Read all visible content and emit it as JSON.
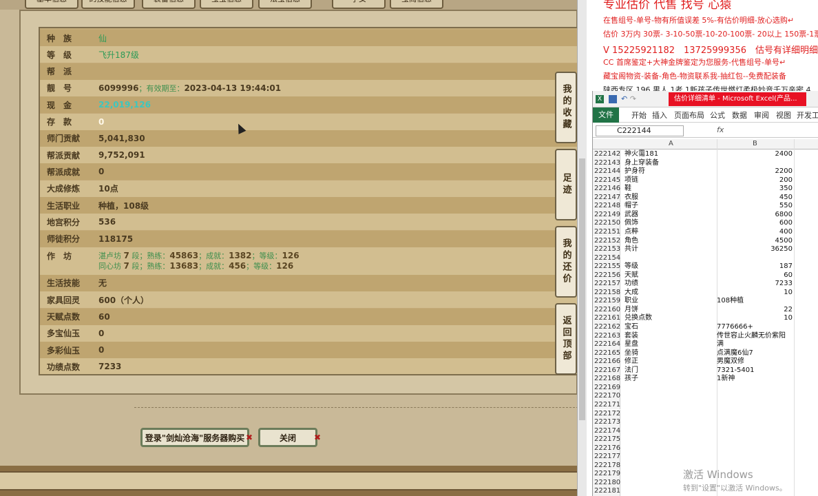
{
  "game": {
    "tabs": [
      "基本信息",
      "的技能信息",
      "装备信息",
      "宝宝信息",
      "法宝信息",
      "子女",
      "宝阁信息"
    ],
    "rows": [
      {
        "label": "种　族",
        "value": "仙",
        "style": "green"
      },
      {
        "label": "等　级",
        "value": "飞升187级",
        "style": "green"
      },
      {
        "label": "帮　派",
        "value": "",
        "style": ""
      },
      {
        "label": "靓　号",
        "value": "6099996",
        "sub": "；有效期至：",
        "value2": "2023-04-13 19:44:01",
        "style": ""
      },
      {
        "label": "现　金",
        "value": "22,019,126",
        "style": "teal"
      },
      {
        "label": "存　款",
        "value": "0",
        "style": "white"
      },
      {
        "label": "师门贡献",
        "value": "5,041,830",
        "style": ""
      },
      {
        "label": "帮派贡献",
        "value": "9,752,091",
        "style": ""
      },
      {
        "label": "帮派成就",
        "value": "0",
        "style": ""
      },
      {
        "label": "大成修炼",
        "value": "10点",
        "style": ""
      },
      {
        "label": "生活职业",
        "value": "种植，108级",
        "style": ""
      },
      {
        "label": "地宫积分",
        "value": "536",
        "style": ""
      },
      {
        "label": "师徒积分",
        "value": "118175",
        "style": ""
      },
      {
        "label": "生活技能",
        "value": "无",
        "style": ""
      },
      {
        "label": "家具回灵",
        "value": "600（个人）",
        "style": ""
      },
      {
        "label": "天赋点数",
        "value": "60",
        "style": ""
      },
      {
        "label": "多宝仙玉",
        "value": "0",
        "style": ""
      },
      {
        "label": "多彩仙玉",
        "value": "0",
        "style": ""
      },
      {
        "label": "功绩点数",
        "value": "7233",
        "style": ""
      }
    ],
    "workshop": {
      "label": "作　坊",
      "line1": {
        "name": "湛卢坊",
        "lvl": "7",
        "t1": "段；熟练：",
        "v1": "45863",
        "t2": "；成就：",
        "v2": "1382",
        "t3": "；等级：",
        "v3": "126"
      },
      "line2": {
        "name": "同心坊",
        "lvl": "7",
        "t1": "段；熟练：",
        "v1": "13683",
        "t2": "；成就：",
        "v2": "456",
        "t3": "；等级：",
        "v3": "126"
      }
    },
    "side_buttons": [
      "我的收藏",
      "足迹",
      "我的还价",
      "返回顶部"
    ],
    "login_button": "登录\"剑灿沧海\"服务器购买",
    "close_button": "关闭"
  },
  "ad": {
    "line0": "专业估价 代售 找号 心猿",
    "line1": "在售组号-单号-物有所值误差 5%-有估价明细-放心选购↵",
    "line2": "估价 3万内 30票- 3-10-50票-10-20-100票- 20以上 150票-1票",
    "line3": "V 15225921182　13725999356　估号有详细明细",
    "line4": "CC 首席鉴定+大神金牌鉴定为您服务-代售组号-单号↵",
    "line5": "藏宝阁物资-装备-角色-物资联系我-抽红包--免费配装备",
    "line6": "陕西专区 196 男人 1老 1新孩子传世燃灯柔极妙音千万亲密 4"
  },
  "excel": {
    "window_title": "估价详细清单 - Microsoft Excel(产品...",
    "ribbon_tabs": [
      "文件",
      "开始",
      "插入",
      "页面布局",
      "公式",
      "数据",
      "审阅",
      "视图",
      "开发工"
    ],
    "name_box": "C222144",
    "fx": "fx",
    "col_a": "A",
    "col_b": "B",
    "rows": [
      {
        "n": "222142",
        "a": "神火霭181",
        "b": "2400",
        "num": true
      },
      {
        "n": "222143",
        "a": "身上穿装备",
        "b": "",
        "num": true
      },
      {
        "n": "222144",
        "a": "护身符",
        "b": "2200",
        "num": true
      },
      {
        "n": "222145",
        "a": "项链",
        "b": "200",
        "num": true
      },
      {
        "n": "222146",
        "a": "鞋",
        "b": "350",
        "num": true
      },
      {
        "n": "222147",
        "a": "衣服",
        "b": "450",
        "num": true
      },
      {
        "n": "222148",
        "a": "帽子",
        "b": "550",
        "num": true
      },
      {
        "n": "222149",
        "a": "武器",
        "b": "6800",
        "num": true
      },
      {
        "n": "222150",
        "a": "佩饰",
        "b": "600",
        "num": true
      },
      {
        "n": "222151",
        "a": "点粹",
        "b": "400",
        "num": true
      },
      {
        "n": "222152",
        "a": "角色",
        "b": "4500",
        "num": true
      },
      {
        "n": "222153",
        "a": "共计",
        "b": "36250",
        "num": true
      },
      {
        "n": "222154",
        "a": "",
        "b": "",
        "num": true
      },
      {
        "n": "222155",
        "a": "等级",
        "b": "187",
        "num": true
      },
      {
        "n": "222156",
        "a": "天赋",
        "b": "60",
        "num": true
      },
      {
        "n": "222157",
        "a": "功绩",
        "b": "7233",
        "num": true
      },
      {
        "n": "222158",
        "a": "大成",
        "b": "10",
        "num": true
      },
      {
        "n": "222159",
        "a": "职业",
        "b": "108种植",
        "num": false
      },
      {
        "n": "222160",
        "a": "月饼",
        "b": "22",
        "num": true
      },
      {
        "n": "222161",
        "a": "兑换点数",
        "b": "10",
        "num": true
      },
      {
        "n": "222162",
        "a": "宝石",
        "b": "7776666+",
        "num": false
      },
      {
        "n": "222163",
        "a": "套装",
        "b": "传世容止火麟无价紫阳",
        "num": false
      },
      {
        "n": "222164",
        "a": "星盘",
        "b": "满",
        "num": false
      },
      {
        "n": "222165",
        "a": "坐骑",
        "b": "点满魔6仙7",
        "num": false
      },
      {
        "n": "222166",
        "a": "修正",
        "b": "男魔双修",
        "num": false
      },
      {
        "n": "222167",
        "a": "法门",
        "b": "7321-5401",
        "num": false
      },
      {
        "n": "222168",
        "a": "孩子",
        "b": "1新神",
        "num": false
      },
      {
        "n": "222169",
        "a": "",
        "b": "",
        "num": true
      },
      {
        "n": "222170",
        "a": "",
        "b": "",
        "num": true
      },
      {
        "n": "222171",
        "a": "",
        "b": "",
        "num": true
      },
      {
        "n": "222172",
        "a": "",
        "b": "",
        "num": true
      },
      {
        "n": "222173",
        "a": "",
        "b": "",
        "num": true
      },
      {
        "n": "222174",
        "a": "",
        "b": "",
        "num": true
      },
      {
        "n": "222175",
        "a": "",
        "b": "",
        "num": true
      },
      {
        "n": "222176",
        "a": "",
        "b": "",
        "num": true
      },
      {
        "n": "222177",
        "a": "",
        "b": "",
        "num": true
      },
      {
        "n": "222178",
        "a": "",
        "b": "",
        "num": true
      },
      {
        "n": "222179",
        "a": "",
        "b": "",
        "num": true
      },
      {
        "n": "222180",
        "a": "",
        "b": "",
        "num": true
      },
      {
        "n": "222181",
        "a": "",
        "b": "",
        "num": true
      }
    ]
  },
  "watermark": {
    "line1": "激活 Windows",
    "line2": "转到\"设置\"以激活 Windows。"
  }
}
